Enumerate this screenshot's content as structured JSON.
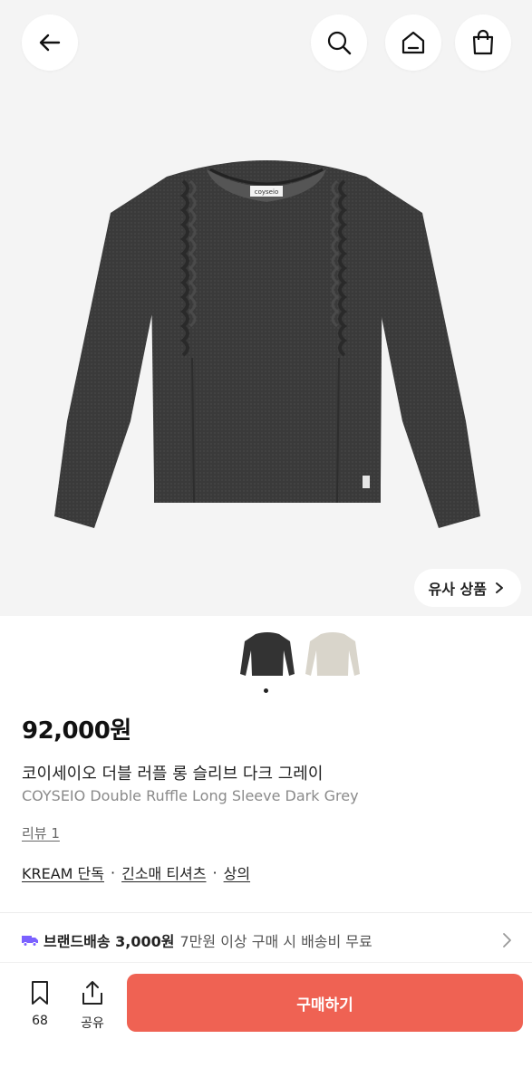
{
  "header": {
    "icons": [
      "back-arrow-icon",
      "search-icon",
      "home-icon",
      "shopping-bag-icon"
    ]
  },
  "product": {
    "price": "92,000원",
    "name_ko": "코이세이오 더블 러플 롱 슬리브 다크 그레이",
    "name_en": "COYSEIO Double Ruffle Long Sleeve Dark Grey",
    "review_label": "리뷰 1",
    "tags": [
      "KREAM 단독",
      "긴소매 티셔츠",
      "상의"
    ],
    "tag_separator": "·",
    "neckline_label_text": "coyseio",
    "colors": {
      "main": "#3a3a3a",
      "alt": "#d9d5cb"
    }
  },
  "similar": {
    "label": "유사 상품"
  },
  "thumbnails": {
    "count": 2,
    "selected_index": 0
  },
  "shipping": {
    "label": "브랜드배송 3,000원",
    "condition": "7만원 이상 구매 시 배송비 무료",
    "icon_color": "#7b61ff"
  },
  "bottom_bar": {
    "bookmark_count": "68",
    "share_label": "공유",
    "buy_label": "구매하기",
    "buy_color": "#ef6253"
  }
}
